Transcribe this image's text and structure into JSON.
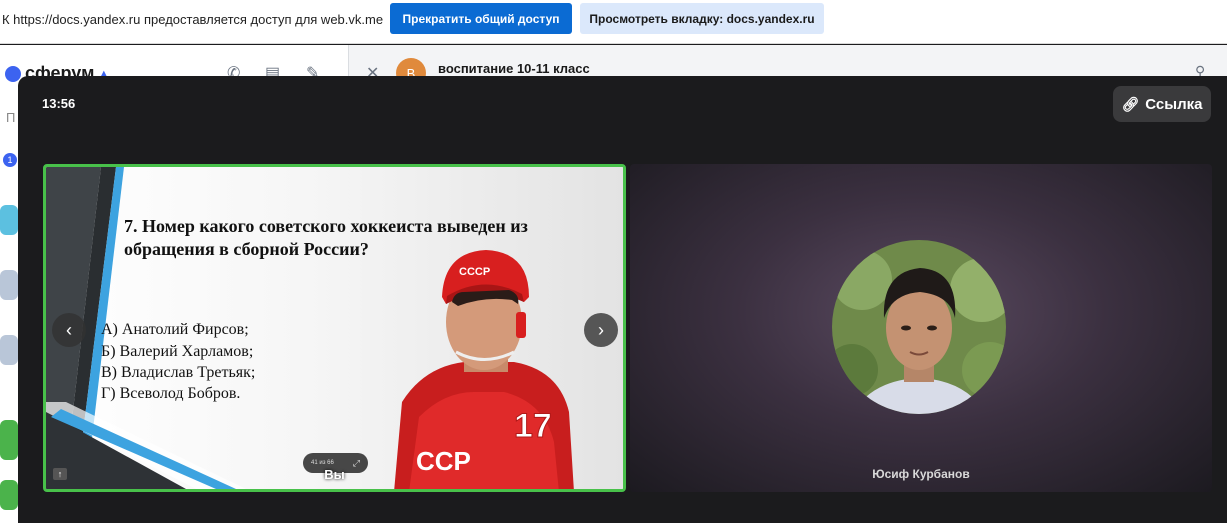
{
  "share_bar": {
    "message": "К https://docs.yandex.ru предоставляется доступ для web.vk.me",
    "stop_label": "Прекратить общий доступ",
    "view_label": "Просмотреть вкладку: docs.yandex.ru"
  },
  "background_app": {
    "logo_text": "сферум",
    "chat_avatar_letter": "В",
    "chat_title": "воспитание 10-11 класс",
    "search_hint": "П",
    "badge_count": "1"
  },
  "call": {
    "clock": "13:56",
    "link_label": "Ссылка",
    "self_tile": {
      "name": "Вы",
      "slide": {
        "question": "7. Номер какого советского хоккеиста выведен из обращения в сборной России?",
        "options": [
          "А) Анатолий Фирсов;",
          "Б) Валерий Харламов;",
          "В) Владислав Третьяк;",
          "Г) Всеволод Бобров."
        ],
        "helmet_text": "СССР",
        "jersey_text": "ССР",
        "jersey_number": "17"
      },
      "page_indicator": "41 из 66"
    },
    "other_tile": {
      "name": "Юсиф Курбанов"
    }
  }
}
